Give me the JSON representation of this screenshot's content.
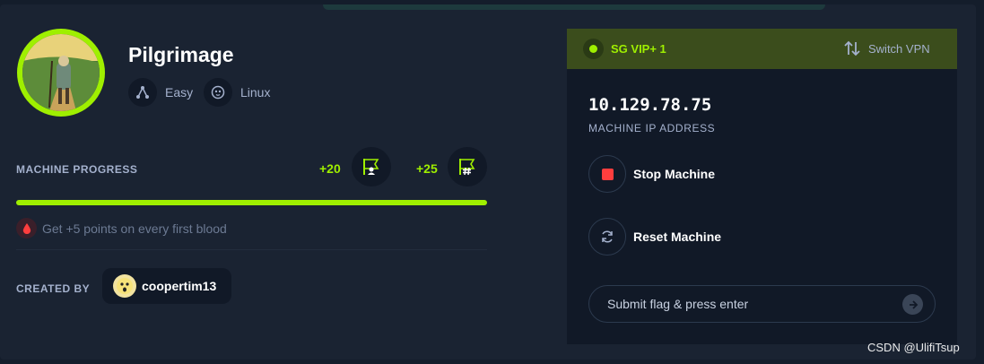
{
  "machine": {
    "name": "Pilgrimage",
    "difficulty": "Easy",
    "os": "Linux"
  },
  "progress": {
    "label": "MACHINE PROGRESS",
    "user_points": "+20",
    "root_points": "+25",
    "percent": 100,
    "blood_note": "Get +5 points on every first blood"
  },
  "creator": {
    "label": "CREATED BY",
    "name": "coopertim13"
  },
  "vpn": {
    "server": "SG VIP+ 1",
    "switch_label": "Switch VPN"
  },
  "connection": {
    "ip": "10.129.78.75",
    "ip_label": "MACHINE IP ADDRESS",
    "stop_label": "Stop Machine",
    "reset_label": "Reset Machine"
  },
  "flag_input": {
    "placeholder": "Submit flag & press enter",
    "value": ""
  },
  "watermark": "CSDN @UlifiTsup",
  "colors": {
    "accent": "#9fef00",
    "background": "#1a2332",
    "panel": "#111927",
    "vpn_bar": "#3b4d1c",
    "stop": "#ff3e3e"
  }
}
